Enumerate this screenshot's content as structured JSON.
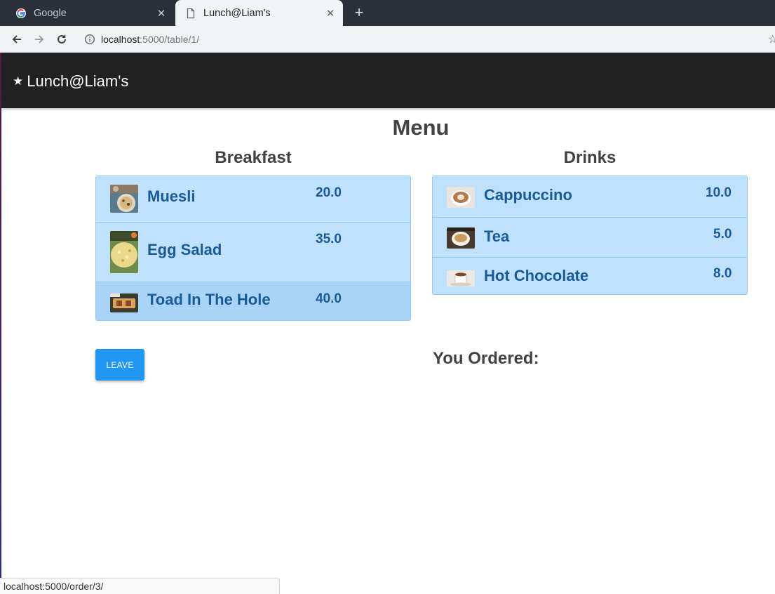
{
  "browser": {
    "tabs": [
      {
        "title": "Google",
        "active": false
      },
      {
        "title": "Lunch@Liam's",
        "active": true
      }
    ],
    "url_host": "localhost",
    "url_path": ":5000/table/1/",
    "status_url": "localhost:5000/order/3/"
  },
  "app": {
    "brand": "Lunch@Liam's",
    "menu_title": "Menu",
    "breakfast": {
      "title": "Breakfast",
      "items": [
        {
          "name": "Muesli",
          "price": "20.0"
        },
        {
          "name": "Egg Salad",
          "price": "35.0"
        },
        {
          "name": "Toad In The Hole",
          "price": "40.0"
        }
      ]
    },
    "drinks": {
      "title": "Drinks",
      "items": [
        {
          "name": "Cappuccino",
          "price": "10.0"
        },
        {
          "name": "Tea",
          "price": "5.0"
        },
        {
          "name": "Hot Chocolate",
          "price": "8.0"
        }
      ]
    },
    "leave_label": "LEAVE",
    "ordered_title": "You Ordered:"
  },
  "colors": {
    "navbar": "#212121",
    "panel": "#bfe1fb",
    "item_text": "#1a5a96",
    "button": "#2196f3"
  },
  "icons": {
    "brand": "star-icon",
    "back": "arrow-left-icon",
    "forward": "arrow-right-icon",
    "reload": "reload-icon",
    "site_info": "info-icon",
    "bookmark": "star-outline-icon"
  }
}
